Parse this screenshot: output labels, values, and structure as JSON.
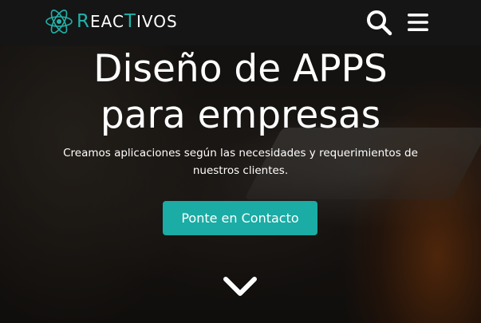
{
  "brand": {
    "name_parts": [
      "R",
      "EAC",
      "T",
      "IVOS"
    ]
  },
  "navbar": {
    "search_icon": "search-icon",
    "menu_icon": "hamburger-menu-icon"
  },
  "hero": {
    "title_line1": "Diseño de APPS",
    "title_line2": "para empresas",
    "subtitle": "Creamos aplicaciones según las necesidades y requerimientos de nuestros clientes.",
    "cta_label": "Ponte en Contacto",
    "scroll_icon": "chevron-down-icon"
  },
  "colors": {
    "accent": "#1aaca5",
    "navbar_bg": "#151515",
    "logo_teal": "#22b2aa"
  }
}
